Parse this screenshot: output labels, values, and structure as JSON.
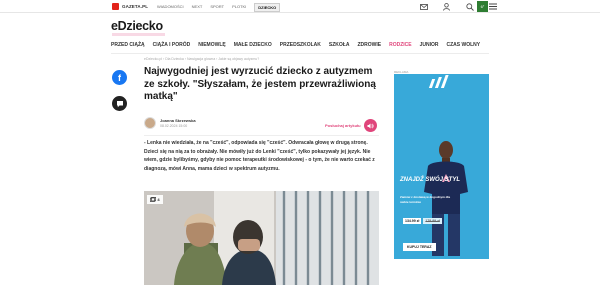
{
  "topbar": {
    "portal_name": "GAZETA.PL",
    "nav": [
      "WIADOMOŚCI",
      "NEXT",
      "SPORT",
      "PLOTKI",
      "DZIECKO"
    ],
    "active_index": 4,
    "weather_label": "6°",
    "icons": [
      "mail-icon",
      "user-icon",
      "search-icon",
      "menu-icon"
    ]
  },
  "brand": {
    "name": "eDziecko"
  },
  "mainnav": {
    "items": [
      "PRZED CIĄŻĄ",
      "CIĄŻA I PORÓD",
      "NIEMOWLĘ",
      "MAŁE DZIECKO",
      "PRZEDSZKOLAK",
      "SZKOŁA",
      "ZDROWIE",
      "RODZICE",
      "JUNIOR",
      "CZAS WOLNY"
    ],
    "highlight_index": 7
  },
  "breadcrumb": "eDziecko.pl › Dla Dziecka › Nawigacja glowna › Jakie są objawy autyzmu?",
  "article": {
    "title": "Najwygodniej jest wyrzucić dziecko z autyzmem ze szkoły. \"Słyszałam, że jestem przewrażliwioną matką\"",
    "author_name": "Joanna Skrzewska",
    "author_date": "08.02.2024 15:00",
    "listen_label": "Posłuchaj artykułu",
    "lead": "- Lenka nie wiedziała, że na \"cześć\", odpowiada się \"cześć\". Odwracała głowę w drugą stronę. Dzieci się na nią za to obrażały. Nie mówiły już do Lenki \"cześć\", tylko pokazywały jej język. Nie wiem, gdzie bylibyśmy, gdyby nie pomoc terapeutki środowiskowej - o tym, że nie warto czekać z diagnozą, mówi Anna, mama dzieci w spektrum autyzmu.",
    "photo_count": "4"
  },
  "ad": {
    "tag": "REKLAMA",
    "headline": "ZNAJDŹ SWÓJ STYL",
    "subline": "Zamów z dostawą w dogodnym dla siebie terminie",
    "price_new": "134.99 zł",
    "price_old": "179.99 zł",
    "cta": "KUPUJ TERAZ"
  },
  "colors": {
    "accent": "#e0457b",
    "ad_bg": "#38a9d9",
    "facebook": "#1877f2"
  }
}
